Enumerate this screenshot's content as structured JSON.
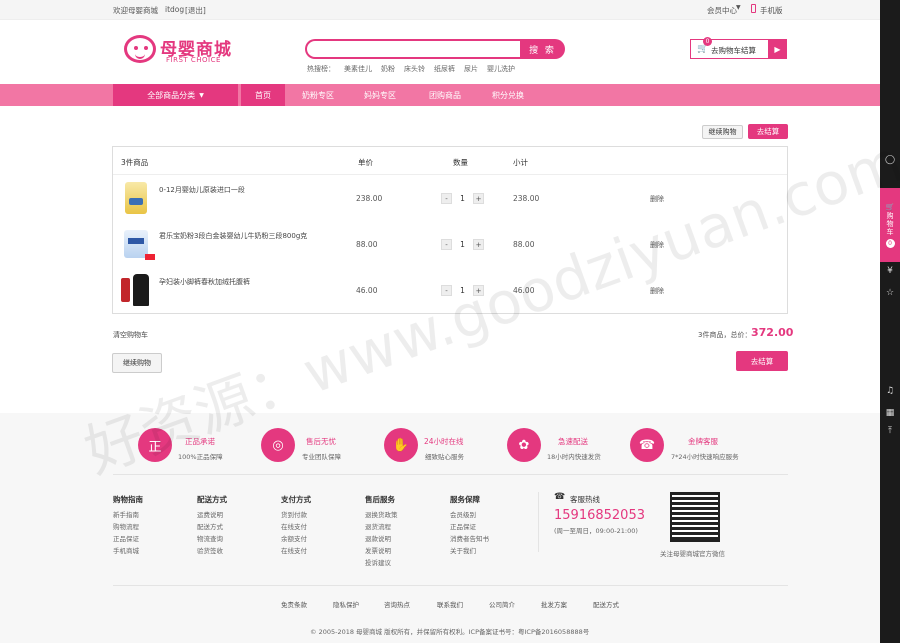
{
  "topbar": {
    "welcome": "欢迎母婴商城",
    "user": "itdog",
    "logout": "[退出]",
    "member": "会员中心",
    "mobile": "手机版"
  },
  "header": {
    "logo_cn": "母婴商城",
    "logo_en": "FIRST CHOICE",
    "search_btn": "搜 索",
    "hot_label": "热搜榜：",
    "hot_words": [
      "美素佳儿",
      "奶粉",
      "床头铃",
      "纸尿裤",
      "尿片",
      "婴儿洗护"
    ],
    "cart_count": "0",
    "cart_label": "去购物车结算"
  },
  "nav": {
    "category": "全部商品分类",
    "items": [
      "首页",
      "奶粉专区",
      "妈妈专区",
      "团购商品",
      "积分兑换"
    ]
  },
  "cart": {
    "continue_top": "继续购物",
    "checkout_top": "去结算",
    "headers": {
      "items": "3件商品",
      "price": "单价",
      "qty": "数量",
      "subtotal": "小计"
    },
    "rows": [
      {
        "name": "0-12月婴幼儿原装进口一段",
        "price": "238.00",
        "qty": "1",
        "subtotal": "238.00",
        "del": "删除"
      },
      {
        "name": "君乐宝奶粉3段白金装婴幼儿牛奶粉三段800g克",
        "price": "88.00",
        "qty": "1",
        "subtotal": "88.00",
        "del": "删除"
      },
      {
        "name": "孕妇装小脚裤春秋加绒托腹裤",
        "price": "46.00",
        "qty": "1",
        "subtotal": "46.00",
        "del": "删除"
      }
    ],
    "clear": "清空购物车",
    "summary_label": "3件商品，总价：",
    "total": "372.00",
    "continue_bottom": "继续购物",
    "checkout_bottom": "去结算"
  },
  "features": [
    {
      "icon": "正",
      "title": "正品承诺",
      "sub": "100%正品保障"
    },
    {
      "icon": "◎",
      "title": "售后无忧",
      "sub": "专业团队保障"
    },
    {
      "icon": "✋",
      "title": "24小时在线",
      "sub": "细致贴心服务"
    },
    {
      "icon": "✿",
      "title": "急速配送",
      "sub": "18小时内快速发货"
    },
    {
      "icon": "☎",
      "title": "金牌客服",
      "sub": "7*24小时快速响应服务"
    }
  ],
  "footer_cols": [
    {
      "title": "购物指南",
      "items": [
        "新手指南",
        "购物流程",
        "正品保证",
        "手机商城"
      ]
    },
    {
      "title": "配送方式",
      "items": [
        "运费说明",
        "配送方式",
        "物流查询",
        "验货签收"
      ]
    },
    {
      "title": "支付方式",
      "items": [
        "货到付款",
        "在线支付",
        "余额支付",
        "在线支付"
      ]
    },
    {
      "title": "售后服务",
      "items": [
        "退换货政策",
        "退货流程",
        "退款说明",
        "发票说明",
        "投诉建议"
      ]
    },
    {
      "title": "服务保障",
      "items": [
        "会员级别",
        "正品保证",
        "消费者告知书",
        "关于我们"
      ]
    }
  ],
  "hotline": {
    "label": "客服热线",
    "number": "15916852053",
    "time": "(周一至周日，09:00-21:00)"
  },
  "qr_caption": "关注母婴商城官方微信",
  "bottom_links": [
    "免责条款",
    "隐私保护",
    "咨询热点",
    "联系我们",
    "公司简介",
    "批发方案",
    "配送方式"
  ],
  "copyright": "© 2005-2018 母婴商城 版权所有，并保留所有权利。ICP备案证书号：粤ICP备2016058888号",
  "sidebar": {
    "cart": "购物车",
    "cart_count": "0"
  },
  "watermark": "好资源：www.goodziyuan.com"
}
